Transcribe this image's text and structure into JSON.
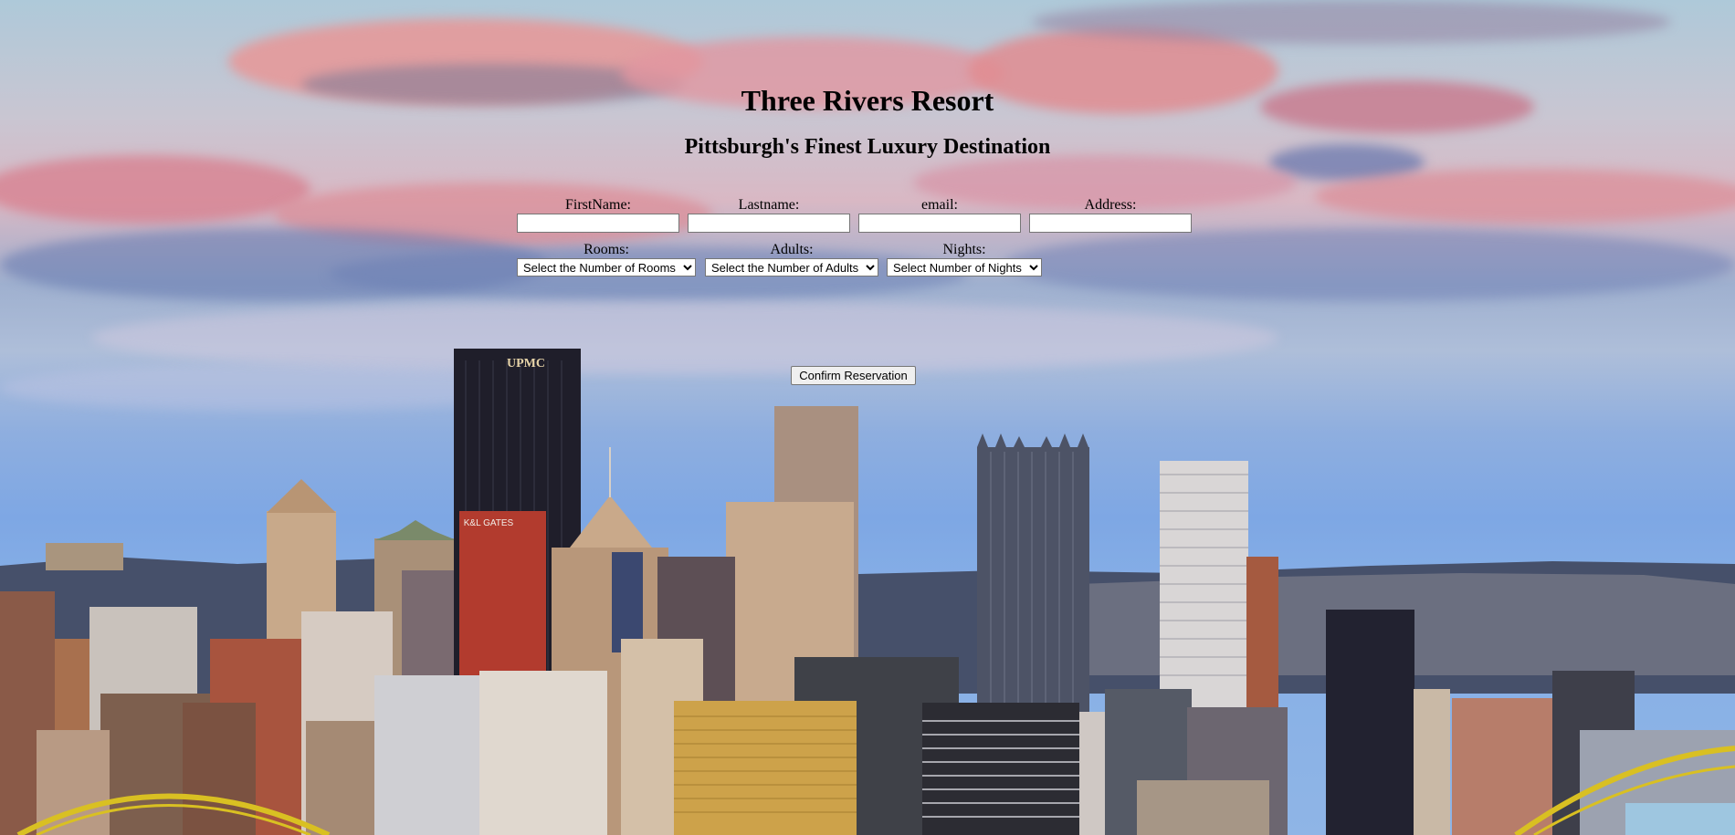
{
  "header": {
    "title": "Three Rivers Resort",
    "subtitle": "Pittsburgh's Finest Luxury Destination"
  },
  "form": {
    "firstname": {
      "label": "FirstName:",
      "value": ""
    },
    "lastname": {
      "label": "Lastname:",
      "value": ""
    },
    "email": {
      "label": "email:",
      "value": ""
    },
    "address": {
      "label": "Address:",
      "value": ""
    },
    "rooms": {
      "label": "Rooms:",
      "selected": "Select the Number of Rooms"
    },
    "adults": {
      "label": "Adults:",
      "selected": "Select the Number of Adults"
    },
    "nights": {
      "label": "Nights:",
      "selected": "Select Number of Nights"
    },
    "submit_label": "Confirm Reservation"
  },
  "background": {
    "depiction": "pittsburgh-skyline-photo",
    "building_sign_1": "UPMC",
    "building_sign_2": "K&L GATES"
  }
}
